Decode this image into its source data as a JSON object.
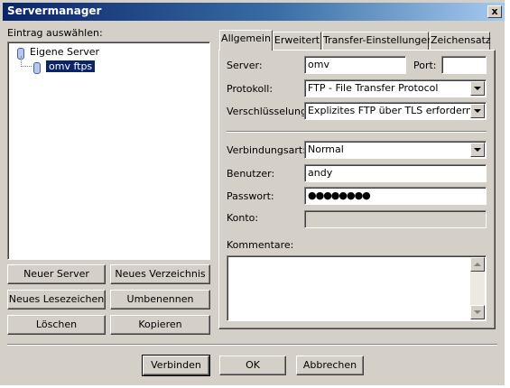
{
  "window": {
    "title": "Servermanager",
    "close_glyph": "x"
  },
  "left": {
    "select_label": "Eintrag auswählen:",
    "tree": {
      "root": "Eigene Server",
      "child": "omv ftps"
    },
    "buttons": {
      "new_server": "Neuer Server",
      "new_folder": "Neues Verzeichnis",
      "new_bookmark": "Neues Lesezeichen",
      "rename": "Umbenennen",
      "delete": "Löschen",
      "copy": "Kopieren"
    }
  },
  "tabs": {
    "general": "Allgemein",
    "advanced": "Erweitert",
    "transfer": "Transfer-Einstellungen",
    "charset": "Zeichensatz"
  },
  "general": {
    "server_label": "Server:",
    "server_value": "omv",
    "port_label": "Port:",
    "port_value": "",
    "protocol_label": "Protokoll:",
    "protocol_value": "FTP - File Transfer Protocol",
    "encryption_label": "Verschlüsselung:",
    "encryption_value": "Explizites FTP über TLS erfordern",
    "logon_label": "Verbindungsart:",
    "logon_value": "Normal",
    "user_label": "Benutzer:",
    "user_value": "andy",
    "password_label": "Passwort:",
    "password_value": "●●●●●●●●",
    "account_label": "Konto:",
    "account_value": "",
    "comments_label": "Kommentare:",
    "comments_value": ""
  },
  "footer": {
    "connect": "Verbinden",
    "ok": "OK",
    "cancel": "Abbrechen"
  },
  "colors": {
    "titlebar_start": "#0a246a",
    "titlebar_end": "#a6caf0",
    "dialog_bg": "#d4d0c8",
    "selection": "#0a246a"
  }
}
